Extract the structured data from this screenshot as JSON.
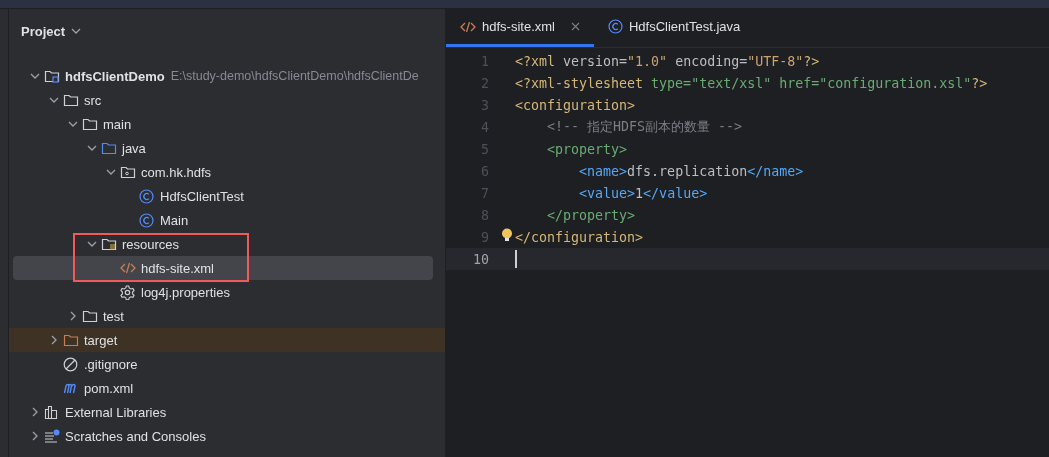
{
  "project_panel": {
    "title": "Project",
    "tree": [
      {
        "kind": "project",
        "name": "hdfsClientDemo",
        "path": "E:\\study-demo\\hdfsClientDemo\\hdfsClientDe",
        "expanded": true,
        "selected": false,
        "children": [
          {
            "kind": "folder",
            "name": "src",
            "expanded": true,
            "selected": false,
            "children": [
              {
                "kind": "folder",
                "name": "main",
                "expanded": true,
                "selected": false,
                "children": [
                  {
                    "kind": "source-folder",
                    "name": "java",
                    "expanded": true,
                    "selected": false,
                    "children": [
                      {
                        "kind": "package",
                        "name": "com.hk.hdfs",
                        "expanded": true,
                        "selected": false,
                        "children": [
                          {
                            "kind": "class",
                            "name": "HdfsClientTest",
                            "selected": false
                          },
                          {
                            "kind": "class",
                            "name": "Main",
                            "selected": false
                          }
                        ]
                      }
                    ]
                  },
                  {
                    "kind": "resources-folder",
                    "name": "resources",
                    "expanded": true,
                    "selected": false,
                    "children": [
                      {
                        "kind": "xml",
                        "name": "hdfs-site.xml",
                        "selected": true
                      },
                      {
                        "kind": "properties",
                        "name": "log4j.properties",
                        "selected": false
                      }
                    ]
                  }
                ]
              },
              {
                "kind": "folder",
                "name": "test",
                "expanded": false,
                "selected": false
              }
            ]
          },
          {
            "kind": "excluded-folder",
            "name": "target",
            "expanded": false,
            "selected": false
          },
          {
            "kind": "gitignore",
            "name": ".gitignore",
            "selected": false
          },
          {
            "kind": "maven",
            "name": "pom.xml",
            "selected": false
          }
        ]
      },
      {
        "kind": "libraries",
        "name": "External Libraries",
        "expanded": false,
        "selected": false
      },
      {
        "kind": "scratches",
        "name": "Scratches and Consoles",
        "expanded": false,
        "selected": false
      }
    ]
  },
  "editor": {
    "tabs": [
      {
        "kind": "xml",
        "label": "hdfs-site.xml",
        "selected": true
      },
      {
        "kind": "class",
        "label": "HdfsClientTest.java",
        "selected": false
      }
    ],
    "lines": [
      {
        "number": "1",
        "current": false,
        "tokens": [
          {
            "kind": "pi",
            "text": "<?xml"
          },
          {
            "kind": "attr",
            "text": " version="
          },
          {
            "kind": "value",
            "text": "\"1.0\""
          },
          {
            "kind": "attr",
            "text": " encoding="
          },
          {
            "kind": "value",
            "text": "\"UTF-8\""
          },
          {
            "kind": "pi",
            "text": "?>"
          }
        ]
      },
      {
        "number": "2",
        "current": false,
        "tokens": [
          {
            "kind": "pi",
            "text": "<?xml-stylesheet"
          },
          {
            "kind": "pi-attr",
            "text": " type=\"text/xsl\" href=\"configuration.xsl\""
          },
          {
            "kind": "pi",
            "text": "?>"
          }
        ]
      },
      {
        "number": "3",
        "current": false,
        "tokens": [
          {
            "kind": "tag",
            "text": "<configuration>"
          }
        ]
      },
      {
        "number": "4",
        "current": false,
        "tokens": [
          {
            "kind": "comment",
            "text": "    <!-- 指定HDFS副本的数量 -->"
          }
        ]
      },
      {
        "number": "5",
        "current": false,
        "tokens": [
          {
            "kind": "tag2",
            "text": "    <property>"
          }
        ]
      },
      {
        "number": "6",
        "current": false,
        "tokens": [
          {
            "kind": "tag3",
            "text": "        <name>"
          },
          {
            "kind": "text",
            "text": "dfs.replication"
          },
          {
            "kind": "tag3",
            "text": "</name>"
          }
        ]
      },
      {
        "number": "7",
        "current": false,
        "tokens": [
          {
            "kind": "tag3",
            "text": "        <value>"
          },
          {
            "kind": "text",
            "text": "1"
          },
          {
            "kind": "tag3",
            "text": "</value>"
          }
        ]
      },
      {
        "number": "8",
        "current": false,
        "tokens": [
          {
            "kind": "tag2",
            "text": "    </property>"
          }
        ]
      },
      {
        "number": "9",
        "current": false,
        "tokens": [
          {
            "kind": "tag",
            "text": "</configuration>"
          }
        ]
      },
      {
        "number": "10",
        "current": true
      }
    ]
  }
}
